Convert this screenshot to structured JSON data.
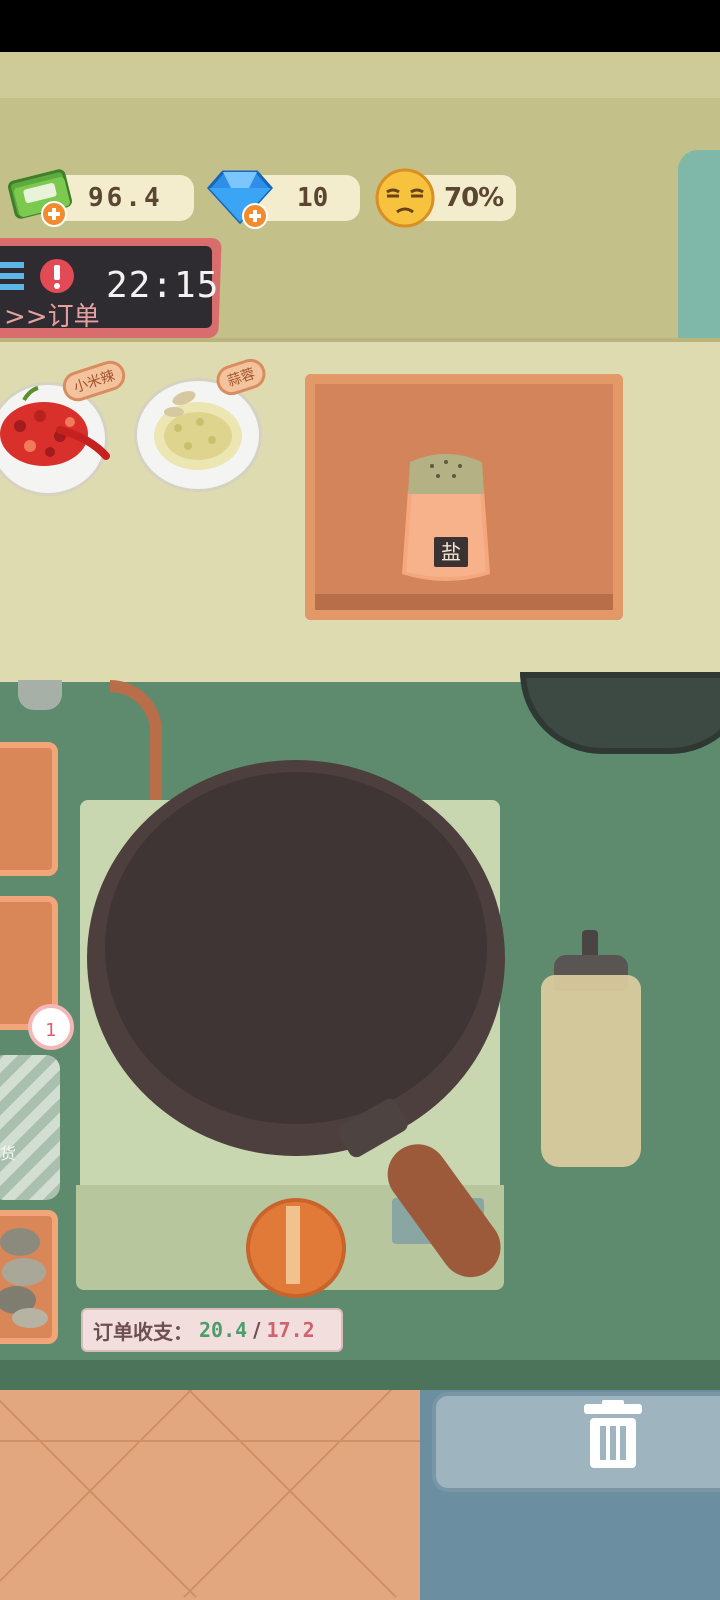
{
  "hud": {
    "money": "96.4",
    "gems": "10",
    "satisfaction": "70%",
    "money_icon": "cash-stack-icon",
    "gem_icon": "blue-diamond-icon",
    "mood_icon": "unamused-face-icon"
  },
  "order_board": {
    "label": ">>订单",
    "time": "22:15",
    "alert_icon": "exclamation-icon"
  },
  "shelf": {
    "chili_tag": "小米辣",
    "garlic_tag": "蒜蓉",
    "salt_label": "盐"
  },
  "side": {
    "stock_label": "货",
    "badge_count": "1"
  },
  "balance": {
    "label": "订单收支：",
    "income": "20.4",
    "separator": "/",
    "expense": "17.2"
  },
  "colors": {
    "income": "#4c9c6d",
    "expense": "#d0616e",
    "counter": "#5e8b6e",
    "shelf": "#dedbb0"
  }
}
